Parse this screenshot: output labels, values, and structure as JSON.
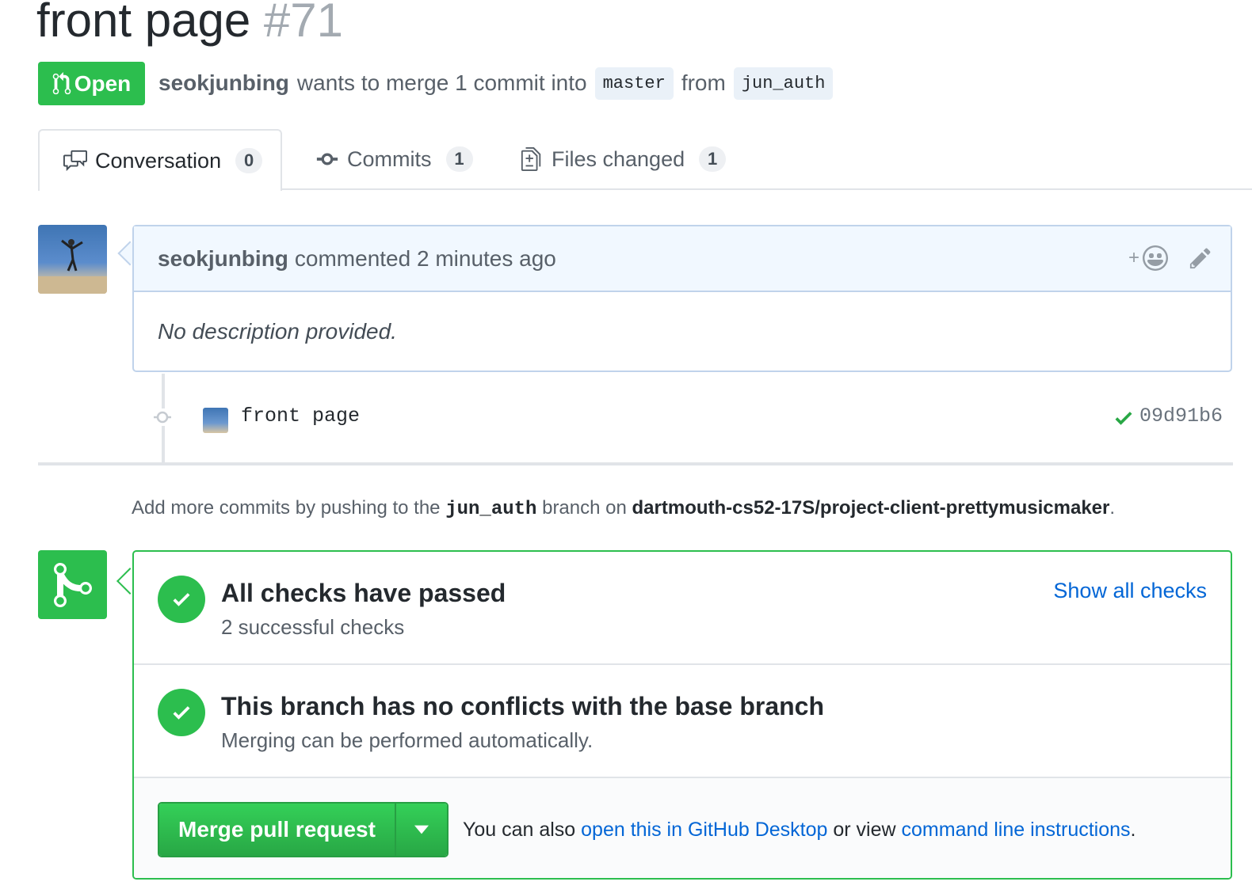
{
  "pr": {
    "title": "front page",
    "number": "#71",
    "state": "Open",
    "author": "seokjunbing",
    "merge_text": "wants to merge 1 commit into",
    "base_branch": "master",
    "from_text": "from",
    "head_branch": "jun_auth"
  },
  "tabs": [
    {
      "label": "Conversation",
      "count": "0"
    },
    {
      "label": "Commits",
      "count": "1"
    },
    {
      "label": "Files changed",
      "count": "1"
    }
  ],
  "comment": {
    "author": "seokjunbing",
    "meta": "commented 2 minutes ago",
    "body": "No description provided."
  },
  "commit": {
    "message": "front page",
    "sha": "09d91b6"
  },
  "push_help": {
    "prefix": "Add more commits by pushing to the",
    "branch": "jun_auth",
    "middle": "branch on",
    "repo": "dartmouth-cs52-17S/project-client-prettymusicmaker",
    "suffix": "."
  },
  "merge": {
    "checks_title": "All checks have passed",
    "checks_sub": "2 successful checks",
    "show_checks": "Show all checks",
    "conflicts_title": "This branch has no conflicts with the base branch",
    "conflicts_sub": "Merging can be performed automatically.",
    "button": "Merge pull request",
    "note_prefix": "You can also",
    "desktop_link": "open this in GitHub Desktop",
    "note_middle": "or view",
    "cli_link": "command line instructions",
    "note_suffix": "."
  },
  "colors": {
    "green": "#2cbe4e",
    "blue": "#0366d6",
    "text": "#24292e",
    "muted": "#586069"
  }
}
